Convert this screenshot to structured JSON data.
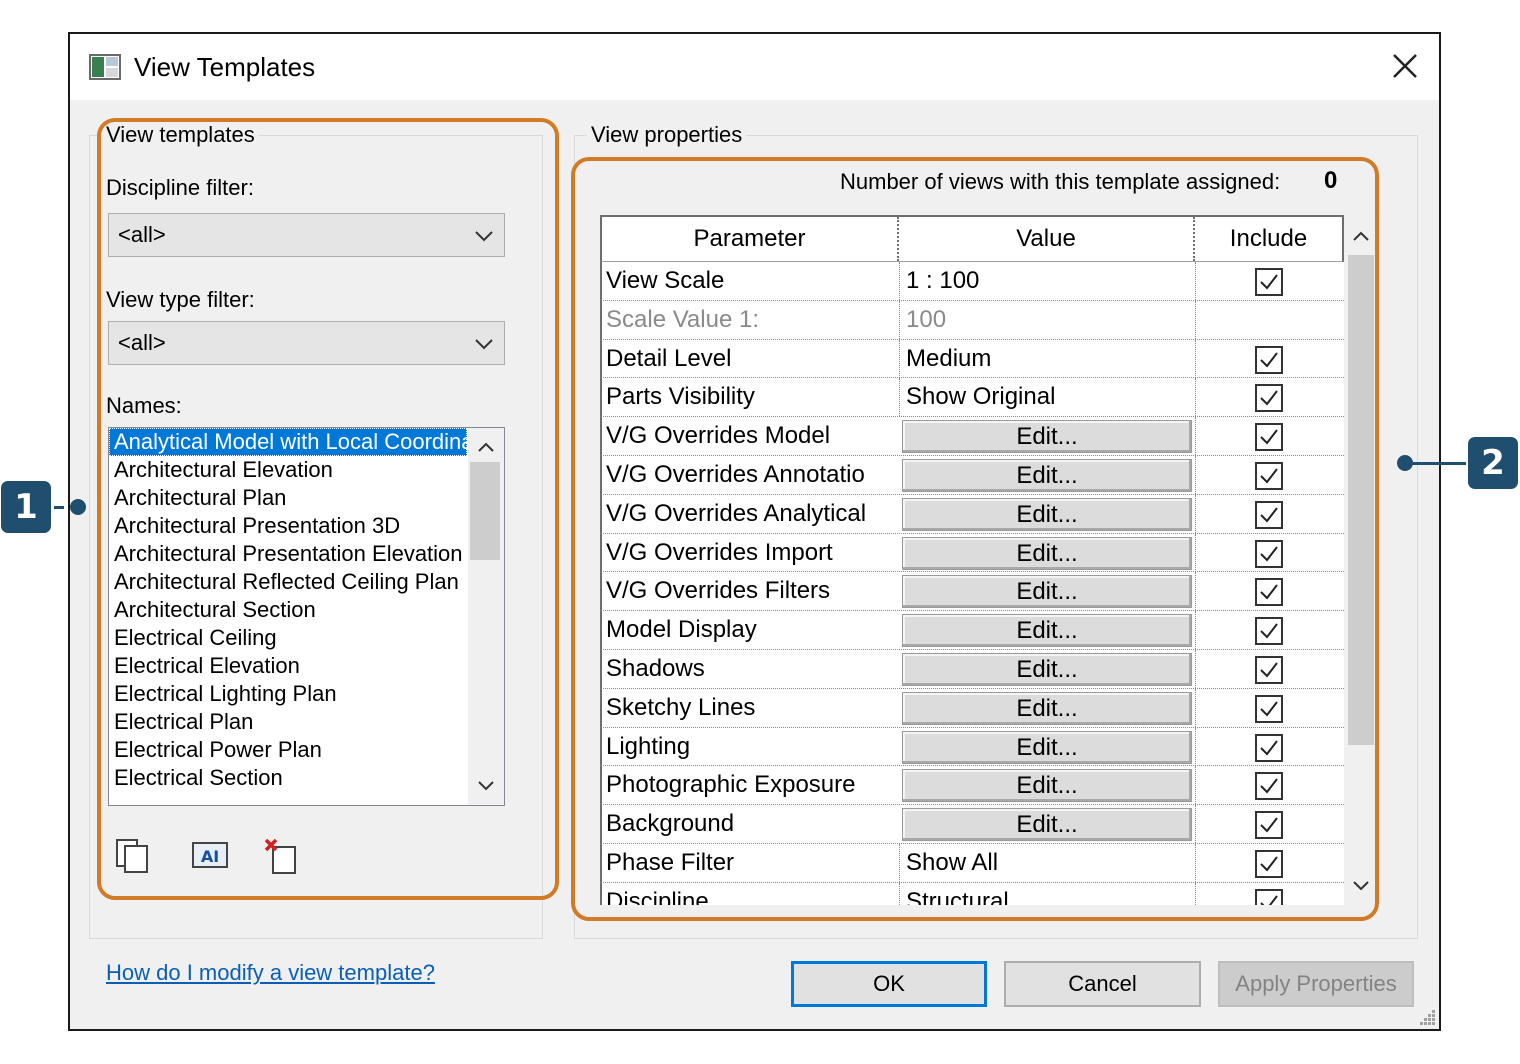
{
  "window": {
    "title": "View Templates",
    "close_icon": "close-icon",
    "app_icon": "view-templates-app-icon"
  },
  "left_panel": {
    "group_label": "View templates",
    "discipline_filter_label": "Discipline filter:",
    "discipline_filter_value": "<all>",
    "view_type_filter_label": "View type filter:",
    "view_type_filter_value": "<all>",
    "names_label": "Names:",
    "names": [
      "Analytical Model with Local Coordinate System",
      "Architectural Elevation",
      "Architectural Plan",
      "Architectural Presentation 3D",
      "Architectural Presentation Elevation",
      "Architectural Reflected Ceiling Plan",
      "Architectural Section",
      "Electrical Ceiling",
      "Electrical Elevation",
      "Electrical Lighting Plan",
      "Electrical Plan",
      "Electrical Power Plan",
      "Electrical Section"
    ],
    "selected_index": 0,
    "tools": [
      "duplicate-icon",
      "rename-icon",
      "delete-icon"
    ]
  },
  "right_panel": {
    "group_label": "View properties",
    "count_label": "Number of views with this template assigned:",
    "count_value": "0",
    "columns": [
      "Parameter",
      "Value",
      "Include"
    ],
    "rows": [
      {
        "parameter": "View Scale",
        "value": "1 : 100",
        "kind": "text",
        "include": true
      },
      {
        "parameter": "Scale Value    1:",
        "value": "100",
        "kind": "text",
        "include": null,
        "dim": true
      },
      {
        "parameter": "Detail Level",
        "value": "Medium",
        "kind": "text",
        "include": true
      },
      {
        "parameter": "Parts Visibility",
        "value": "Show Original",
        "kind": "text",
        "include": true
      },
      {
        "parameter": "V/G Overrides Model",
        "value": "Edit...",
        "kind": "button",
        "include": true
      },
      {
        "parameter": "V/G Overrides Annotatio",
        "value": "Edit...",
        "kind": "button",
        "include": true
      },
      {
        "parameter": "V/G Overrides Analytical",
        "value": "Edit...",
        "kind": "button",
        "include": true
      },
      {
        "parameter": "V/G Overrides Import",
        "value": "Edit...",
        "kind": "button",
        "include": true
      },
      {
        "parameter": "V/G Overrides Filters",
        "value": "Edit...",
        "kind": "button",
        "include": true
      },
      {
        "parameter": "Model Display",
        "value": "Edit...",
        "kind": "button",
        "include": true
      },
      {
        "parameter": "Shadows",
        "value": "Edit...",
        "kind": "button",
        "include": true
      },
      {
        "parameter": "Sketchy Lines",
        "value": "Edit...",
        "kind": "button",
        "include": true
      },
      {
        "parameter": "Lighting",
        "value": "Edit...",
        "kind": "button",
        "include": true
      },
      {
        "parameter": "Photographic Exposure",
        "value": "Edit...",
        "kind": "button",
        "include": true
      },
      {
        "parameter": "Background",
        "value": "Edit...",
        "kind": "button",
        "include": true
      },
      {
        "parameter": "Phase Filter",
        "value": "Show All",
        "kind": "text",
        "include": true
      },
      {
        "parameter": "Discipline",
        "value": "Structural",
        "kind": "text",
        "include": true
      }
    ]
  },
  "footer": {
    "help_link": "How do I modify a view template?",
    "ok_label": "OK",
    "cancel_label": "Cancel",
    "apply_label": "Apply Properties"
  },
  "callouts": {
    "badge_1": "1",
    "badge_2": "2",
    "accent_color": "#d17b27",
    "badge_color": "#1f4e6e"
  }
}
